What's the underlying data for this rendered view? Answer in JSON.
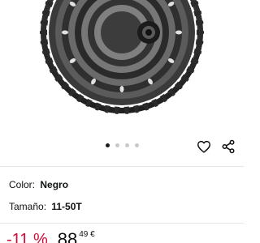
{
  "gallery": {
    "image_name": "cassette-product-image",
    "dot_count": 4,
    "active_index": 0
  },
  "actions": {
    "favorite_icon": "heart-icon",
    "share_icon": "share-icon"
  },
  "attributes": {
    "color_label": "Color:",
    "color_value": "Negro",
    "size_label": "Tamaño:",
    "size_value": "11-50T"
  },
  "price": {
    "discount": "-11 %",
    "integer": "88",
    "decimal": "49 €"
  },
  "colors": {
    "discount": "#cc0c39",
    "text": "#0f1111"
  }
}
